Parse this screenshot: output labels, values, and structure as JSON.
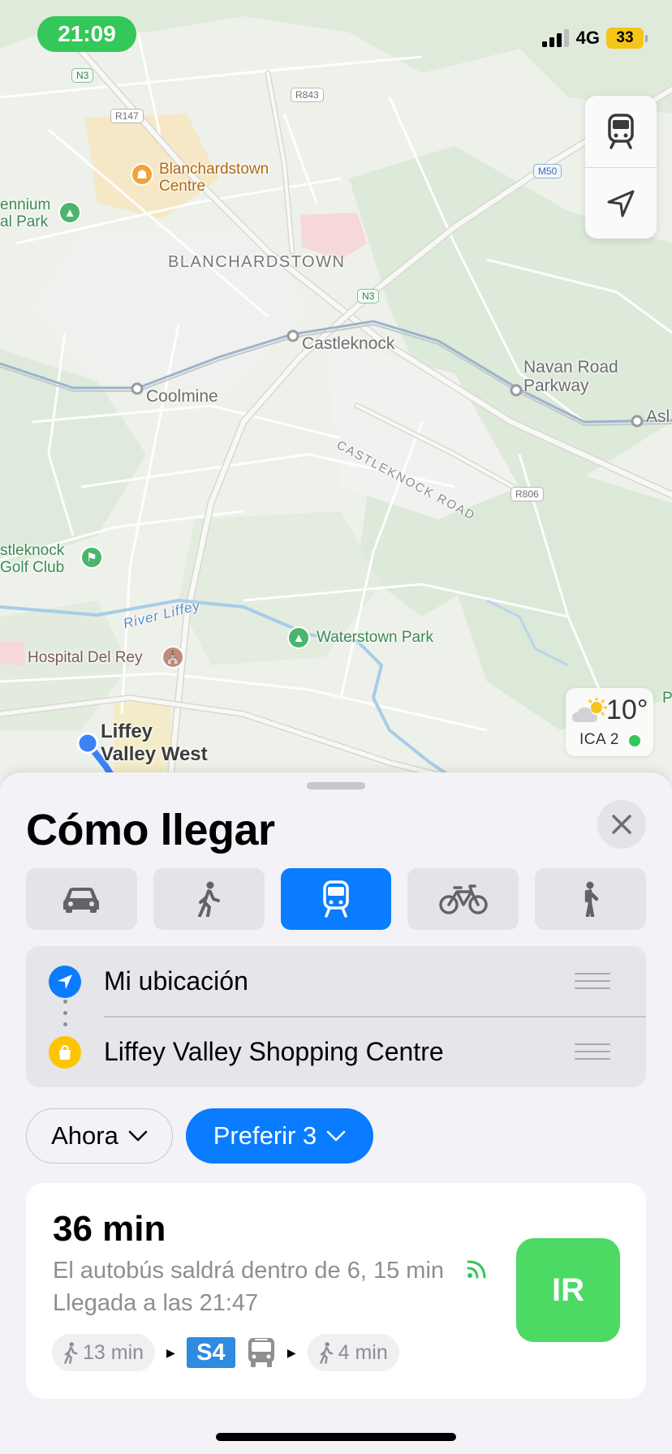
{
  "status_bar": {
    "time": "21:09",
    "network": "4G",
    "battery": "33"
  },
  "map": {
    "labels": {
      "blanchardstown_centre": "Blanchardstown\nCentre",
      "blanchardstown": "BLANCHARDSTOWN",
      "castleknock": "Castleknock",
      "coolmine": "Coolmine",
      "navan_road_parkway": "Navan Road\nParkway",
      "asl": "Asl",
      "castleknock_road": "CASTLEKNOCK ROAD",
      "millennium_park": "ennium\nal Park",
      "castleknock_golf_club": "stleknock\nGolf Club",
      "river_liffey": "River Liffey",
      "waterstown_park": "Waterstown Park",
      "hospital_del_rey": "Hospital Del Rey",
      "liffey_valley_west": "Liffey\nValley West",
      "p_cut": "P"
    },
    "road_shields": {
      "n3_top": "N3",
      "r843": "R843",
      "r147": "R147",
      "m50": "M50",
      "n3_mid": "N3",
      "r806": "R806"
    },
    "weather": {
      "temperature": "10°",
      "air_quality": "ICA 2"
    }
  },
  "sheet": {
    "title": "Cómo llegar",
    "modes": [
      {
        "name": "car-icon",
        "active": false
      },
      {
        "name": "walk-icon",
        "active": false
      },
      {
        "name": "transit-icon",
        "active": true
      },
      {
        "name": "bike-icon",
        "active": false
      },
      {
        "name": "ride-icon",
        "active": false
      }
    ],
    "origin": "Mi ubicación",
    "destination": "Liffey Valley Shopping Centre",
    "time_option": "Ahora",
    "preference_option": "Preferir 3"
  },
  "result": {
    "duration": "36 min",
    "departure": "El autobús saldrá dentro de 6, 15 min",
    "arrival": "Llegada a las 21:47",
    "go_label": "IR",
    "steps": {
      "walk1": "13 min",
      "bus_line": "S4",
      "walk2": "4 min"
    }
  },
  "colors": {
    "accent": "#0a7cff",
    "go": "#4cd964",
    "status_green": "#34c759",
    "battery": "#f5c518",
    "bus_line": "#2e8be0"
  }
}
